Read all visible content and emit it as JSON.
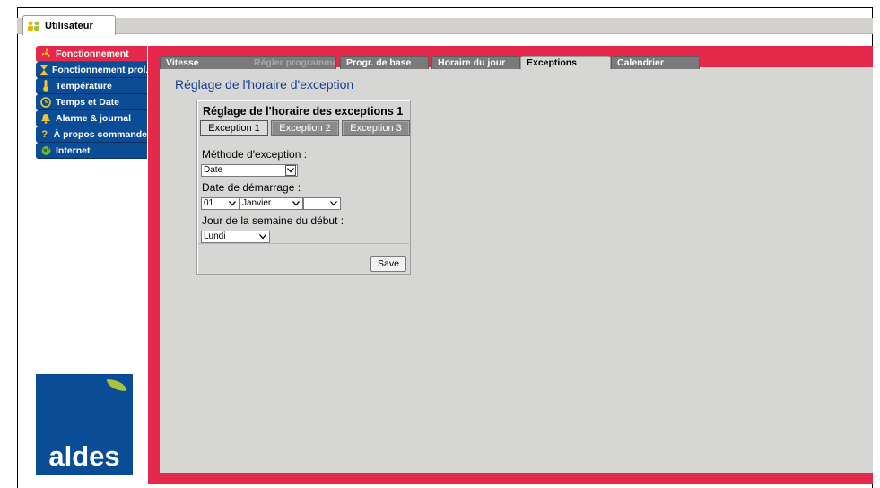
{
  "window": {
    "user_tab_label": "Utilisateur"
  },
  "sidebar": {
    "items": [
      {
        "label": "Fonctionnement",
        "icon": "fan-icon",
        "active": true
      },
      {
        "label": "Fonctionnement prol.",
        "icon": "hourglass-icon",
        "active": false
      },
      {
        "label": "Température",
        "icon": "thermometer-icon",
        "active": false
      },
      {
        "label": "Temps et Date",
        "icon": "clock-icon",
        "active": false
      },
      {
        "label": "Alarme & journal",
        "icon": "bell-icon",
        "active": false
      },
      {
        "label": "À propos commande",
        "icon": "question-icon",
        "active": false
      },
      {
        "label": "Internet",
        "icon": "globe-icon",
        "active": false
      }
    ]
  },
  "logo": {
    "text": "aldes"
  },
  "tabs": [
    {
      "label": "Vitesse",
      "state": "normal"
    },
    {
      "label": "Régler programme",
      "state": "disabled"
    },
    {
      "label": "Progr. de base",
      "state": "normal"
    },
    {
      "label": "Horaire du jour",
      "state": "normal"
    },
    {
      "label": "Exceptions",
      "state": "active"
    },
    {
      "label": "Calendrier",
      "state": "normal"
    }
  ],
  "page": {
    "heading": "Réglage de l'horaire d'exception"
  },
  "panel": {
    "title": "Réglage de l'horaire des exceptions 1",
    "exception_tabs": [
      "Exception 1",
      "Exception 2",
      "Exception 3"
    ],
    "method_label": "Méthode d'exception :",
    "method_value": "Date",
    "start_date_label": "Date de démarrage :",
    "start_day_value": "01",
    "start_month_value": "Janvier",
    "start_year_value": "",
    "weekday_label": "Jour de la semaine du début :",
    "weekday_value": "Lundi",
    "save_label": "Save"
  },
  "colors": {
    "brand_blue": "#0b4c96",
    "accent_red": "#e4294a",
    "content_grey": "#d6d6d4",
    "heading_blue": "#1a3d8f"
  }
}
